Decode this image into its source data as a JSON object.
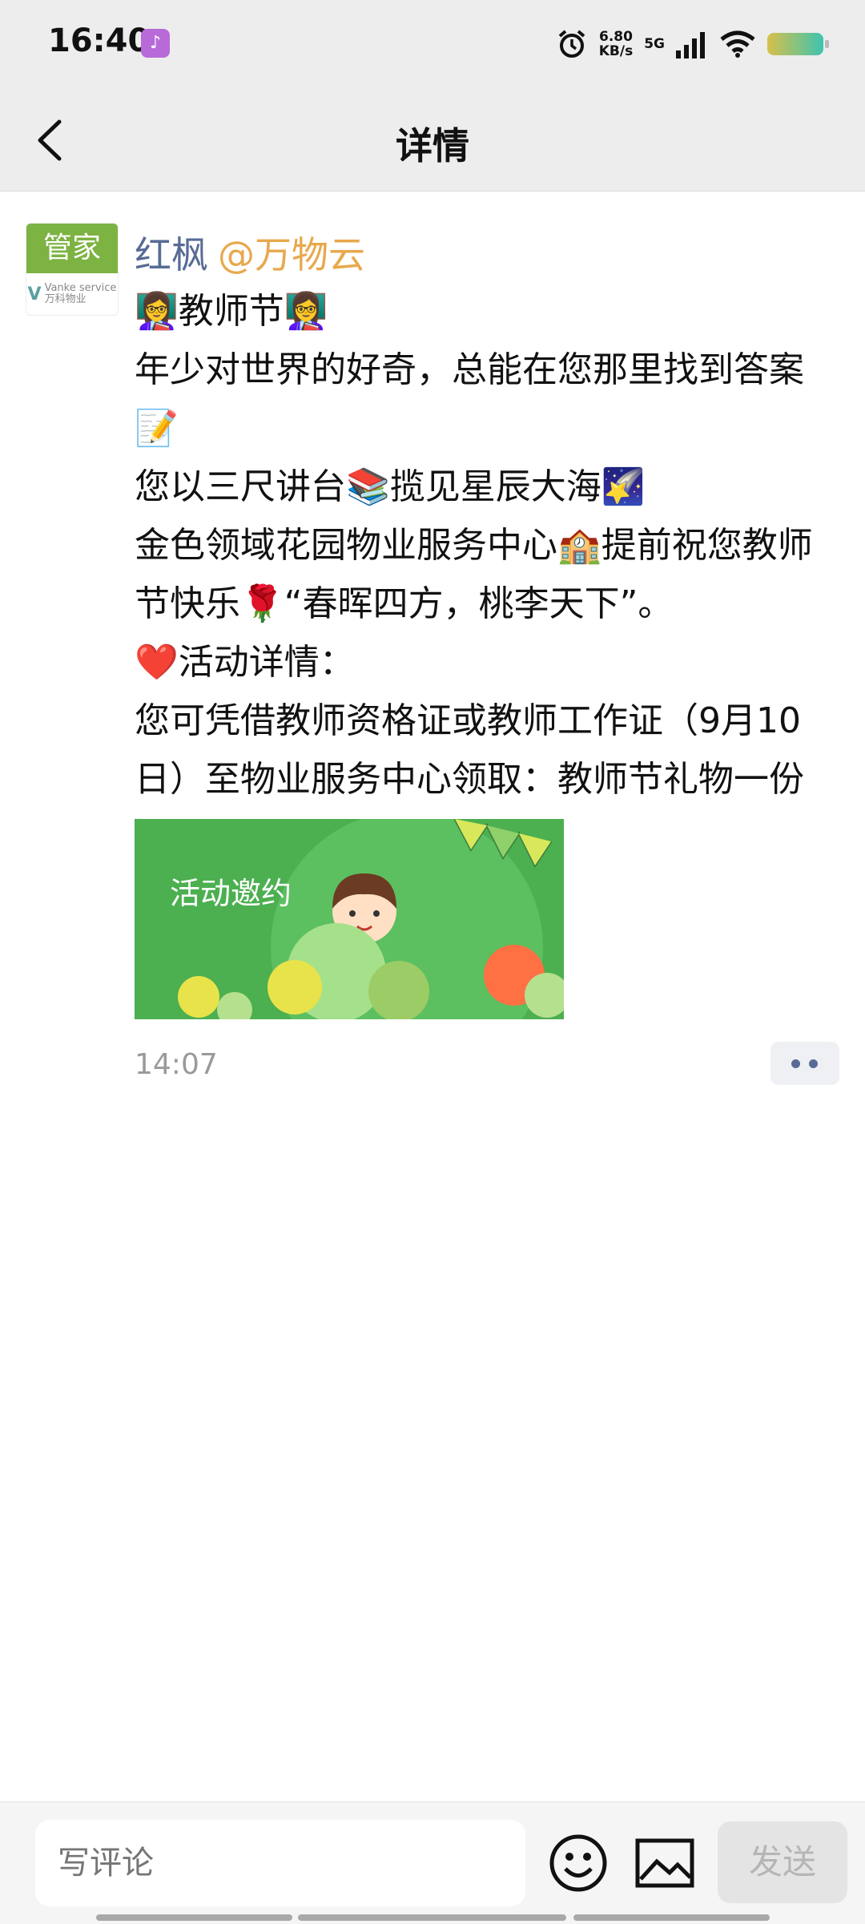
{
  "status_bar": {
    "time": "16:40",
    "app_icon": "tiktok-icon",
    "net_speed_value": "6.80",
    "net_speed_unit": "KB/s",
    "network": "5G",
    "icons": [
      "alarm-icon",
      "signal-icon",
      "wifi-icon",
      "battery-icon"
    ]
  },
  "nav": {
    "back_icon": "chevron-left-icon",
    "title": "详情"
  },
  "post": {
    "avatar": {
      "top_label": "管家",
      "brand_en": "Vanke service",
      "brand_cn": "万科物业"
    },
    "author": "红枫",
    "mention": "@万物云",
    "lines": [
      "👩‍🏫教师节👩‍🏫",
      "年少对世界的好奇，总能在您那里找到答案📝",
      "您以三尺讲台📚揽见星辰大海🌠",
      "金色领域花园物业服务中心🏫提前祝您教师节快乐🌹“春晖四方，桃李天下”。",
      "❤️活动详情：",
      "您可凭借教师资格证或教师工作证（9月10日）至物业服务中心领取：教师节礼物一份"
    ],
    "image": {
      "text": "活动邀约",
      "accent": "#4caf50"
    },
    "time": "14:07",
    "more_icon": "more-dots-icon"
  },
  "bottom": {
    "input_placeholder": "写评论",
    "emoji_icon": "emoji-icon",
    "image_icon": "image-icon",
    "send_label": "发送"
  },
  "colors": {
    "link_blue": "#576b95",
    "mention_orange": "#e8a84c",
    "avatar_green": "#7cb342"
  }
}
